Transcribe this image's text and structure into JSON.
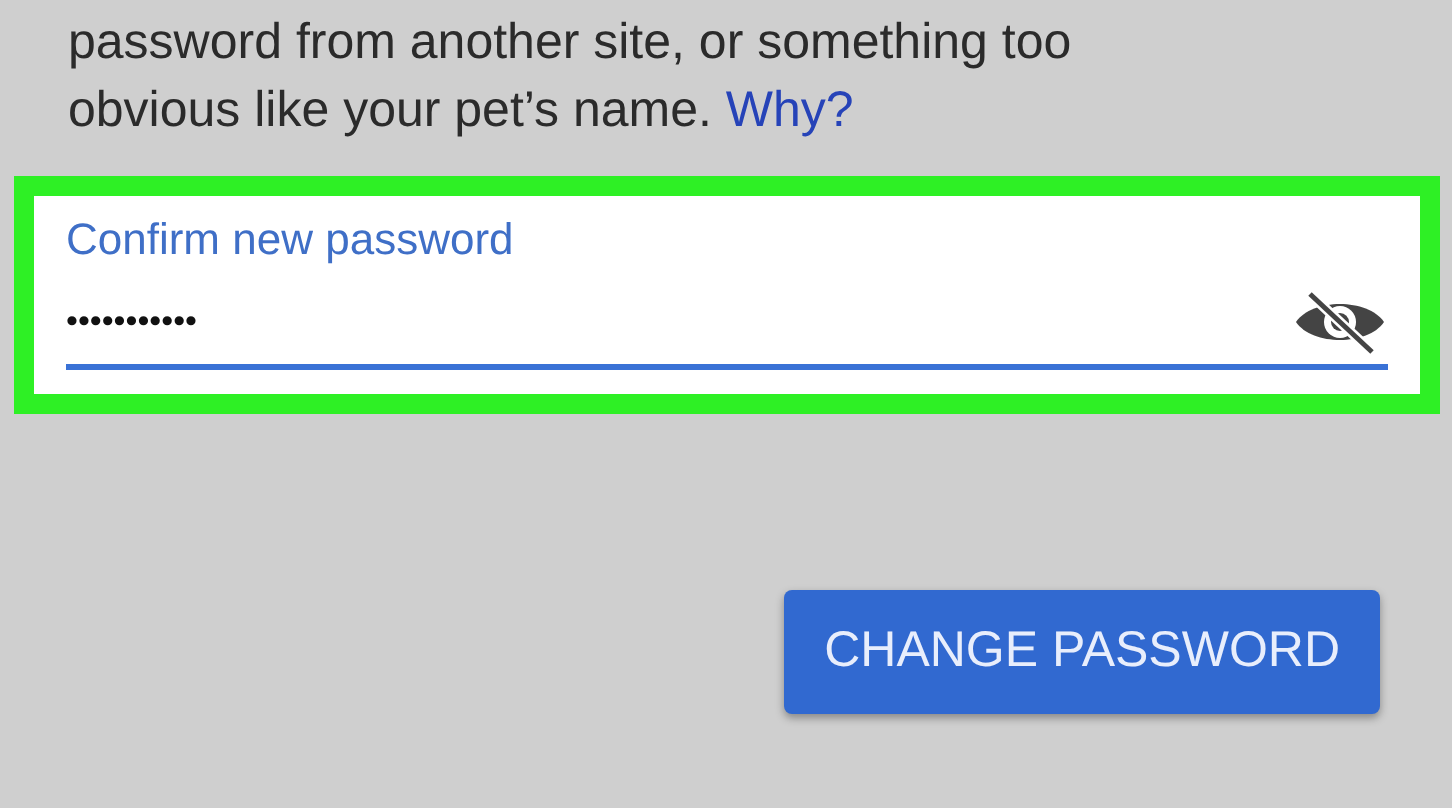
{
  "hint": {
    "lines": [
      "password from another site, or something too",
      "obvious like your pet’s name."
    ],
    "link": "Why?"
  },
  "confirm_field": {
    "label": "Confirm new password",
    "value": "•••••••••••",
    "highlighted": true,
    "focused": true
  },
  "button": {
    "label": "CHANGE PASSWORD"
  }
}
